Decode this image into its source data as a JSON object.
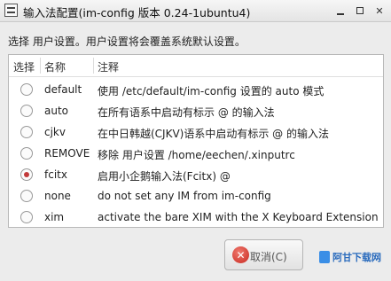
{
  "window": {
    "title": "输入法配置(im-config 版本 0.24-1ubuntu4)",
    "controls": {
      "minimize": "minimize",
      "maximize": "maximize",
      "close": "✕"
    }
  },
  "instruction": "选择 用户设置。用户设置将会覆盖系统默认设置。",
  "list": {
    "headers": {
      "select": "选择",
      "name": "名称",
      "note": "注释"
    },
    "rows": [
      {
        "name": "default",
        "description": "使用 /etc/default/im-config 设置的 auto 模式",
        "selected": false
      },
      {
        "name": "auto",
        "description": "在所有语系中启动有标示 @ 的输入法",
        "selected": false
      },
      {
        "name": "cjkv",
        "description": "在中日韩越(CJKV)语系中启动有标示 @ 的输入法",
        "selected": false
      },
      {
        "name": "REMOVE",
        "description": "移除 用户设置 /home/eechen/.xinputrc",
        "selected": false
      },
      {
        "name": "fcitx",
        "description": "启用小企鹅输入法(Fcitx) @",
        "selected": true
      },
      {
        "name": "none",
        "description": "do not set any IM from im-config",
        "selected": false
      },
      {
        "name": "xim",
        "description": "activate the bare XIM with the X Keyboard Extension",
        "selected": false
      }
    ]
  },
  "buttons": {
    "cancel": "取消(C)"
  },
  "watermark": {
    "text": "阿甘下载网"
  },
  "colors": {
    "radio_selected": "#c23a3a",
    "cancel_icon": "#d0362c"
  }
}
